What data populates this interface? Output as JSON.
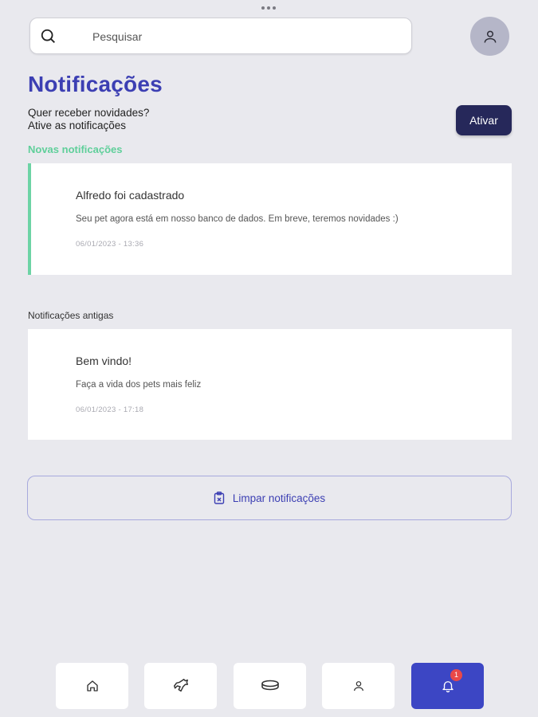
{
  "search": {
    "placeholder": "Pesquisar",
    "icon": "search-icon"
  },
  "header": {
    "avatar_icon": "user-icon"
  },
  "title": "Notificações",
  "promo": {
    "line1": "Quer receber novidades?",
    "line2": "Ative as notificações",
    "button_label": "Ativar"
  },
  "sections": {
    "new_label": "Novas notificações",
    "old_label": "Notificações antigas"
  },
  "new_notifications": [
    {
      "title": "Alfredo foi cadastrado",
      "message": "Seu pet agora está em nosso banco de dados. Em breve, teremos novidades :)",
      "time": "06/01/2023 - 13:36"
    }
  ],
  "old_notifications": [
    {
      "title": "Bem vindo!",
      "message": "Faça a vida dos pets mais feliz",
      "time": "06/01/2023 - 17:18"
    }
  ],
  "clear_button": {
    "label": "Limpar notificações",
    "icon": "clipboard-icon"
  },
  "bottom_nav": {
    "items": [
      {
        "icon": "home-icon"
      },
      {
        "icon": "pet-icon"
      },
      {
        "icon": "bowl-icon"
      },
      {
        "icon": "user-icon"
      },
      {
        "icon": "bell-icon",
        "badge": "1",
        "active": true
      }
    ]
  },
  "colors": {
    "accent": "#3c3fb3",
    "new_section": "#5fcf9a",
    "activate_button": "#26285a",
    "badge": "#e94848",
    "nav_active": "#3c46c4"
  }
}
